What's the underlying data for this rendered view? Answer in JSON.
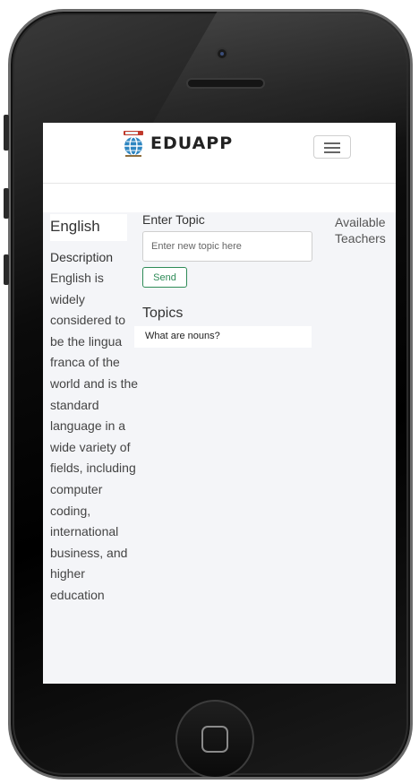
{
  "app": {
    "brand": "EDUAPP"
  },
  "subject": {
    "title": "English",
    "description_label": "Description",
    "description": "English is widely considered to be the lingua franca of the world and is the standard language in a wide variety of fields, including computer coding, international business, and higher education"
  },
  "topic_form": {
    "label": "Enter Topic",
    "placeholder": "Enter new topic here",
    "value": "",
    "send_label": "Send"
  },
  "topics": {
    "title": "Topics",
    "items": [
      {
        "label": "What are nouns?"
      }
    ]
  },
  "teachers": {
    "title": "Available Teachers"
  },
  "colors": {
    "accent_green": "#2e8b57",
    "content_bg": "#f4f5f8",
    "device_body": "#000000"
  }
}
